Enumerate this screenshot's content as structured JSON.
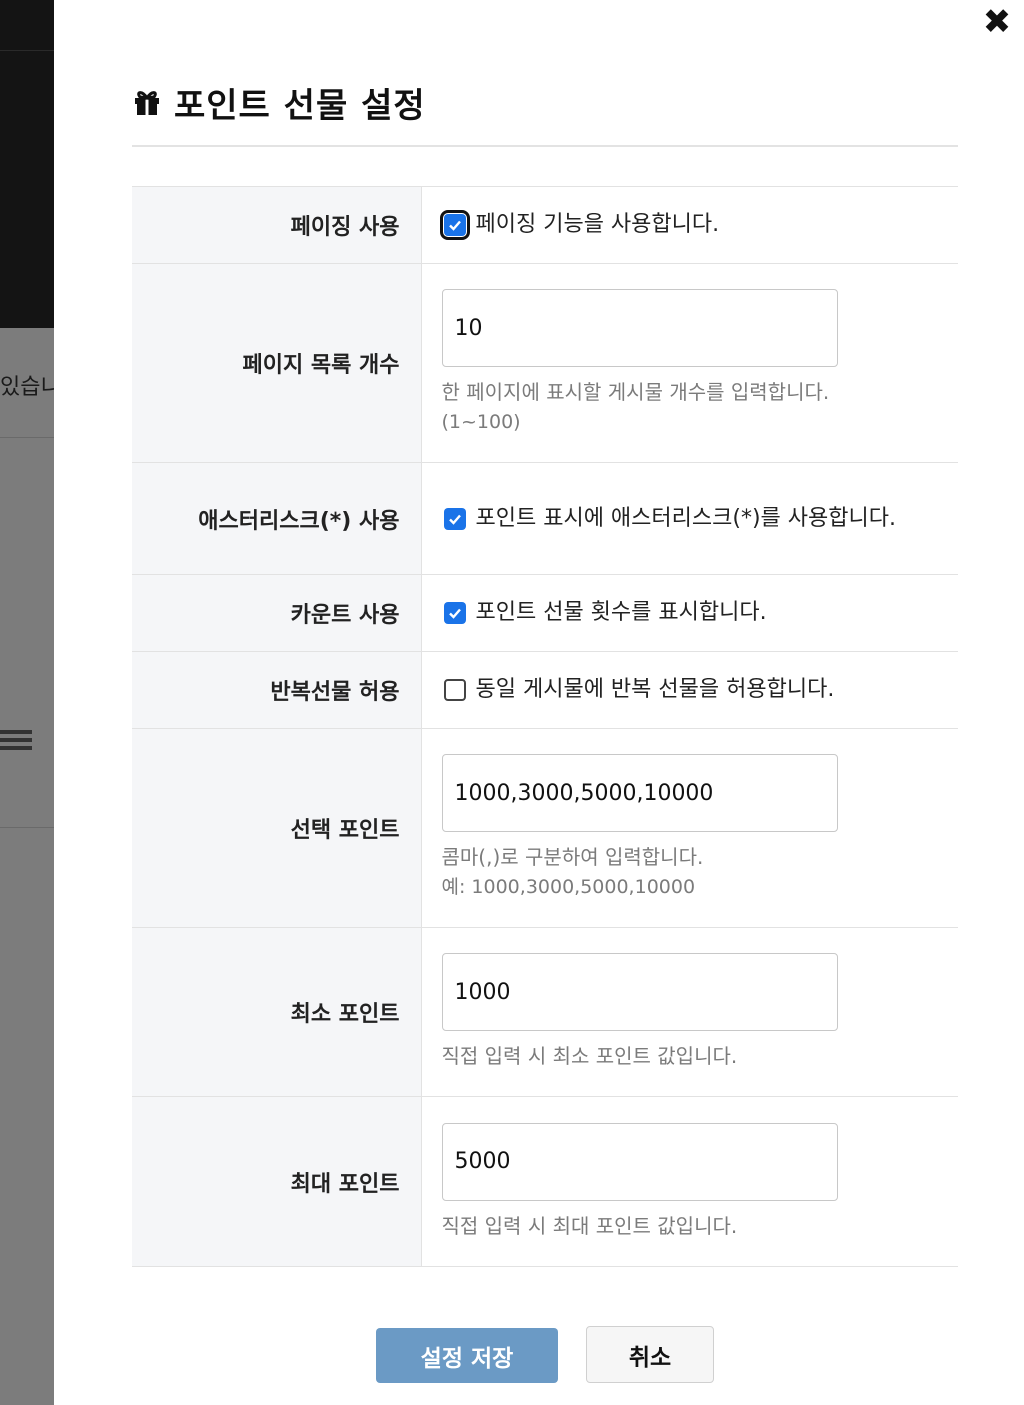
{
  "background": {
    "partial_text": "있습니",
    "list_icon": "list-icon"
  },
  "modal": {
    "title": "포인트 선물 설정",
    "title_icon": "gift-icon",
    "close_icon": "✖"
  },
  "rows": {
    "paging": {
      "label": "페이징 사용",
      "checked": true,
      "text": "페이징 기능을 사용합니다."
    },
    "page_count": {
      "label": "페이지 목록 개수",
      "value": "10",
      "help1": "한 페이지에 표시할 게시물 개수를 입력합니다.",
      "help2": "(1~100)"
    },
    "asterisk": {
      "label": "애스터리스크(*) 사용",
      "checked": true,
      "text": "포인트 표시에 애스터리스크(*)를 사용합니다."
    },
    "count": {
      "label": "카운트 사용",
      "checked": true,
      "text": "포인트 선물 횟수를 표시합니다."
    },
    "repeat": {
      "label": "반복선물 허용",
      "checked": false,
      "text": "동일 게시물에 반복 선물을 허용합니다."
    },
    "select_points": {
      "label": "선택 포인트",
      "value": "1000,3000,5000,10000",
      "help1": "콤마(,)로 구분하여 입력합니다.",
      "help2": "예: 1000,3000,5000,10000"
    },
    "min_point": {
      "label": "최소 포인트",
      "value": "1000",
      "help1": "직접 입력 시 최소 포인트 값입니다."
    },
    "max_point": {
      "label": "최대 포인트",
      "value": "5000",
      "help1": "직접 입력 시 최대 포인트 값입니다."
    }
  },
  "buttons": {
    "save": "설정 저장",
    "cancel": "취소"
  },
  "colors": {
    "checkbox_on": "#1a73e8",
    "save_button": "#6b9ac5",
    "label_bg": "#f5f6f8"
  }
}
